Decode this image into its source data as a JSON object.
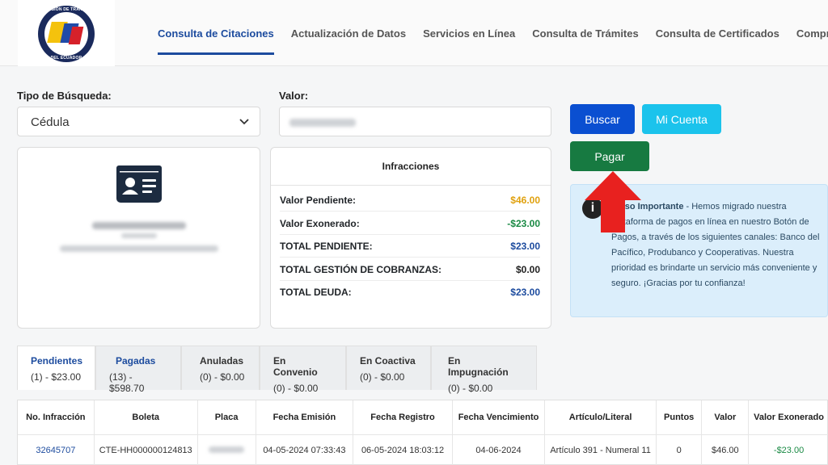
{
  "header": {
    "logo_alt": "Comisión de Tránsito del Ecuador",
    "logo_top_text": "COMISIÓN DE TRÁNSITO",
    "logo_bottom_text": "DEL ECUADOR",
    "nav": [
      {
        "label": "Consulta de Citaciones",
        "active": true
      },
      {
        "label": "Actualización de Datos",
        "active": false
      },
      {
        "label": "Servicios en Línea",
        "active": false
      },
      {
        "label": "Consulta de Trámites",
        "active": false
      },
      {
        "label": "Consulta de Certificados",
        "active": false
      },
      {
        "label": "Comproba",
        "active": false
      }
    ]
  },
  "search": {
    "type_label": "Tipo de Búsqueda:",
    "type_value": "Cédula",
    "value_label": "Valor:",
    "value_value": ""
  },
  "buttons": {
    "buscar": "Buscar",
    "mi_cuenta": "Mi Cuenta",
    "pagar": "Pagar"
  },
  "infracciones": {
    "title": "Infracciones",
    "rows": [
      {
        "label": "Valor Pendiente:",
        "value": "$46.00",
        "color": "#e0a10e"
      },
      {
        "label": "Valor Exonerado:",
        "value": "-$23.00",
        "color": "#1a8a44"
      },
      {
        "label": "TOTAL PENDIENTE:",
        "value": "$23.00",
        "color": "#1c4b9e"
      },
      {
        "label": "TOTAL GESTIÓN DE COBRANZAS:",
        "value": "$0.00",
        "color": "#222222"
      },
      {
        "label": "TOTAL DEUDA:",
        "value": "$23.00",
        "color": "#1c4b9e"
      }
    ]
  },
  "notice": {
    "bold": "Aviso Importante",
    "text": " - Hemos migrado nuestra plataforma de pagos en línea en nuestro Botón de Pagos, a través de los siguientes canales: Banco del Pacífico, Produbanco y Cooperativas. Nuestra prioridad es brindarte un servicio más conveniente y seguro. ¡Gracias por tu confianza!"
  },
  "tabs": [
    {
      "label": "Pendientes",
      "count": "(1) - $23.00",
      "active": true
    },
    {
      "label": "Pagadas",
      "count": "(13) - $598.70",
      "active": false
    },
    {
      "label": "Anuladas",
      "count": "(0) - $0.00",
      "active": false
    },
    {
      "label": "En Convenio",
      "count": "(0) - $0.00",
      "active": false
    },
    {
      "label": "En Coactiva",
      "count": "(0) - $0.00",
      "active": false
    },
    {
      "label": "En Impugnación",
      "count": "(0) - $0.00",
      "active": false
    }
  ],
  "table": {
    "columns": [
      "No. Infracción",
      "Boleta",
      "Placa",
      "Fecha Emisión",
      "Fecha Registro",
      "Fecha Vencimiento",
      "Artículo/Literal",
      "Puntos",
      "Valor",
      "Valor Exonerado"
    ],
    "rows": [
      [
        "32645707",
        "CTE-HH000000124813",
        "",
        "04-05-2024 07:33:43",
        "06-05-2024 18:03:12",
        "04-06-2024",
        "Artículo 391 - Numeral 11",
        "0",
        "$46.00",
        "-$23.00"
      ]
    ]
  },
  "colors": {
    "primary": "#1c4b9e",
    "buscar": "#0a4fd1",
    "mi_cuenta": "#1bc3ec",
    "pagar": "#177a41",
    "annotation_arrow": "#e8211f"
  },
  "icons": [
    "id-card-icon",
    "chevron-down-icon",
    "info-icon",
    "red-arrow-up-icon"
  ]
}
